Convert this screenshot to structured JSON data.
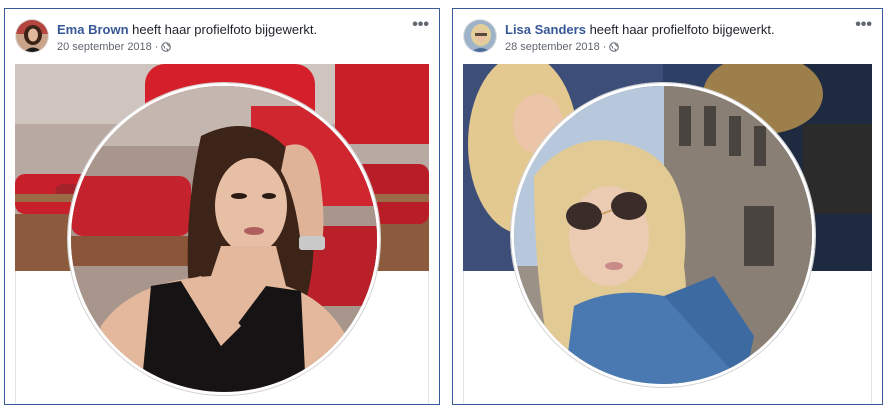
{
  "posts": [
    {
      "author": "Ema Brown",
      "action": "heeft haar profielfoto bijgewerkt.",
      "date": "20 september 2018",
      "separator": "·",
      "privacy_icon": "globe-icon",
      "more_icon": "more-options-icon",
      "more_label": "•••"
    },
    {
      "author": "Lisa Sanders",
      "action": "heeft haar profielfoto bijgewerkt.",
      "date": "28 september 2018",
      "separator": "·",
      "privacy_icon": "globe-icon",
      "more_icon": "more-options-icon",
      "more_label": "•••"
    }
  ],
  "colors": {
    "name_link": "#385898",
    "border": "#3b5998",
    "meta_text": "#616770"
  }
}
